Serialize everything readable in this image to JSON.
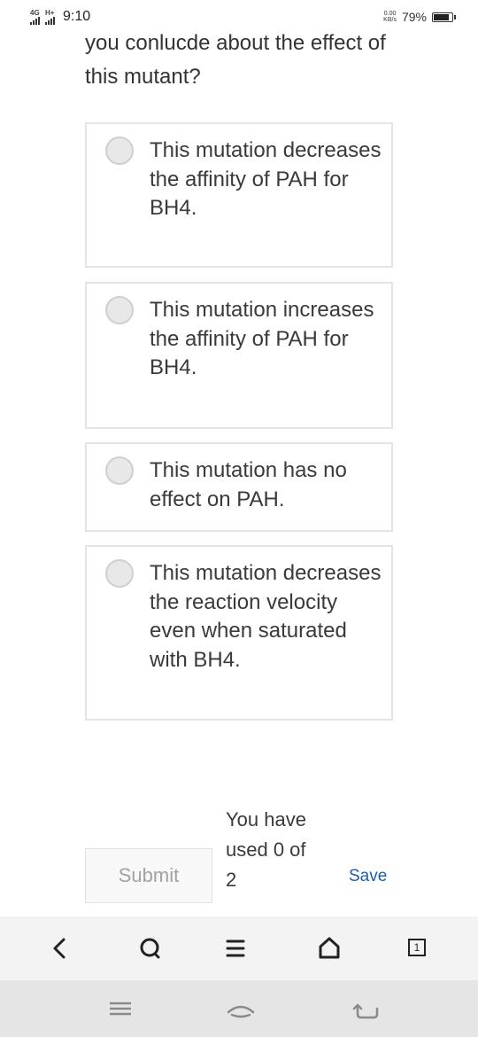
{
  "status_bar": {
    "signal1_label": "4G",
    "signal2_label": "H+",
    "time": "9:10",
    "net_speed_value": "0.00",
    "net_speed_unit": "KB/s",
    "battery_text": "79%",
    "battery_level": 0.79
  },
  "question": {
    "text": "you conlucde about the effect of this mutant?"
  },
  "options": [
    {
      "label": "This mutation decreases the affinity of PAH for BH4.",
      "selected": false
    },
    {
      "label": "This mutation increases the affinity of PAH for BH4.",
      "selected": false
    },
    {
      "label": "This mutation has no effect on PAH.",
      "selected": false
    },
    {
      "label": "This mutation decreases the reaction velocity even when saturated with BH4.",
      "selected": false
    }
  ],
  "actions": {
    "submit_label": "Submit",
    "attempts_text": "You have used 0 of 2",
    "save_label": "Save"
  },
  "browser_toolbar": {
    "tab_count": "1",
    "icons": [
      "back-icon",
      "search-icon",
      "menu-icon",
      "home-icon",
      "tabs-icon"
    ]
  },
  "nav_bar": {
    "icons": [
      "recent-apps-icon",
      "home-icon",
      "back-icon"
    ]
  },
  "colors": {
    "link": "#1c5fa6",
    "border": "#e4e4e4",
    "submit_text": "#a2a2a2"
  }
}
